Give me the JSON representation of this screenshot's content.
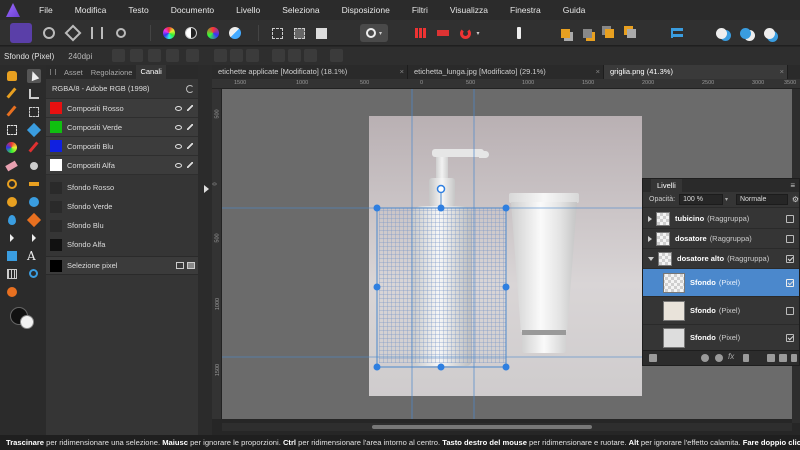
{
  "menu": [
    "File",
    "Modifica",
    "Testo",
    "Documento",
    "Livello",
    "Seleziona",
    "Disposizione",
    "Filtri",
    "Visualizza",
    "Finestra",
    "Guida"
  ],
  "context": {
    "layer_label": "Sfondo (Pixel)",
    "dpi": "240dpi"
  },
  "panel": {
    "tabs": [
      "Asset",
      "Regolazione",
      "Canali"
    ],
    "active_tab": "Canali",
    "color_mode": "RGBA/8 - Adobe RGB (1998)",
    "composite_channels": [
      {
        "label": "Compositi Rosso",
        "color": "#e81010"
      },
      {
        "label": "Compositi Verde",
        "color": "#10c010"
      },
      {
        "label": "Compositi Blu",
        "color": "#1020e0"
      },
      {
        "label": "Compositi Alfa",
        "color": "#ffffff"
      }
    ],
    "background_channels": [
      {
        "label": "Sfondo Rosso"
      },
      {
        "label": "Sfondo Verde"
      },
      {
        "label": "Sfondo Blu"
      },
      {
        "label": "Sfondo Alfa"
      }
    ],
    "pixel_selection": "Selezione pixel"
  },
  "documents": [
    {
      "title": "etichette applicate [Modificato] (18.1%)",
      "active": false
    },
    {
      "title": "etichetta_lunga.jpg [Modificato] (29.1%)",
      "active": false
    },
    {
      "title": "griglia.png (41.3%)",
      "active": true
    }
  ],
  "ruler_h_labels": [
    "1500",
    "1000",
    "500",
    "0",
    "500",
    "1000",
    "1500",
    "2000",
    "2500",
    "3000",
    "3500"
  ],
  "ruler_v_labels": [
    "500",
    "0",
    "500",
    "1000",
    "1500"
  ],
  "layers": {
    "title": "Livelli",
    "opacity_label": "Opacità:",
    "opacity_value": "100 %",
    "blend_mode": "Normale",
    "rows": [
      {
        "name": "tubicino",
        "type": "(Raggruppa)",
        "checked": false,
        "selected": false
      },
      {
        "name": "dosatore",
        "type": "(Raggruppa)",
        "checked": false,
        "selected": false
      },
      {
        "name": "dosatore alto",
        "type": "(Raggruppa)",
        "checked": true,
        "selected": false
      },
      {
        "name": "Sfondo",
        "type": "(Pixel)",
        "checked": true,
        "selected": true
      },
      {
        "name": "Sfondo",
        "type": "(Pixel)",
        "checked": false,
        "selected": false
      },
      {
        "name": "Sfondo",
        "type": "(Pixel)",
        "checked": true,
        "selected": false
      }
    ]
  },
  "status": {
    "k1": "Trascinare",
    "t1": " per ridimensionare una selezione. ",
    "k2": "Maiusc",
    "t2": " per ignorare le proporzioni. ",
    "k3": "Ctrl",
    "t3": " per ridimensionare l'area intorno al centro. ",
    "k4": "Tasto destro del mouse",
    "t4": " per ridimensionare e ruotare. ",
    "k5": "Alt",
    "t5": " per ignorare l'effetto calamita. ",
    "k6": "Fare doppio clic"
  },
  "colors": {
    "selection": "#4b88cc",
    "handle": "#2f7fe0",
    "accent": "#9b6bff"
  }
}
